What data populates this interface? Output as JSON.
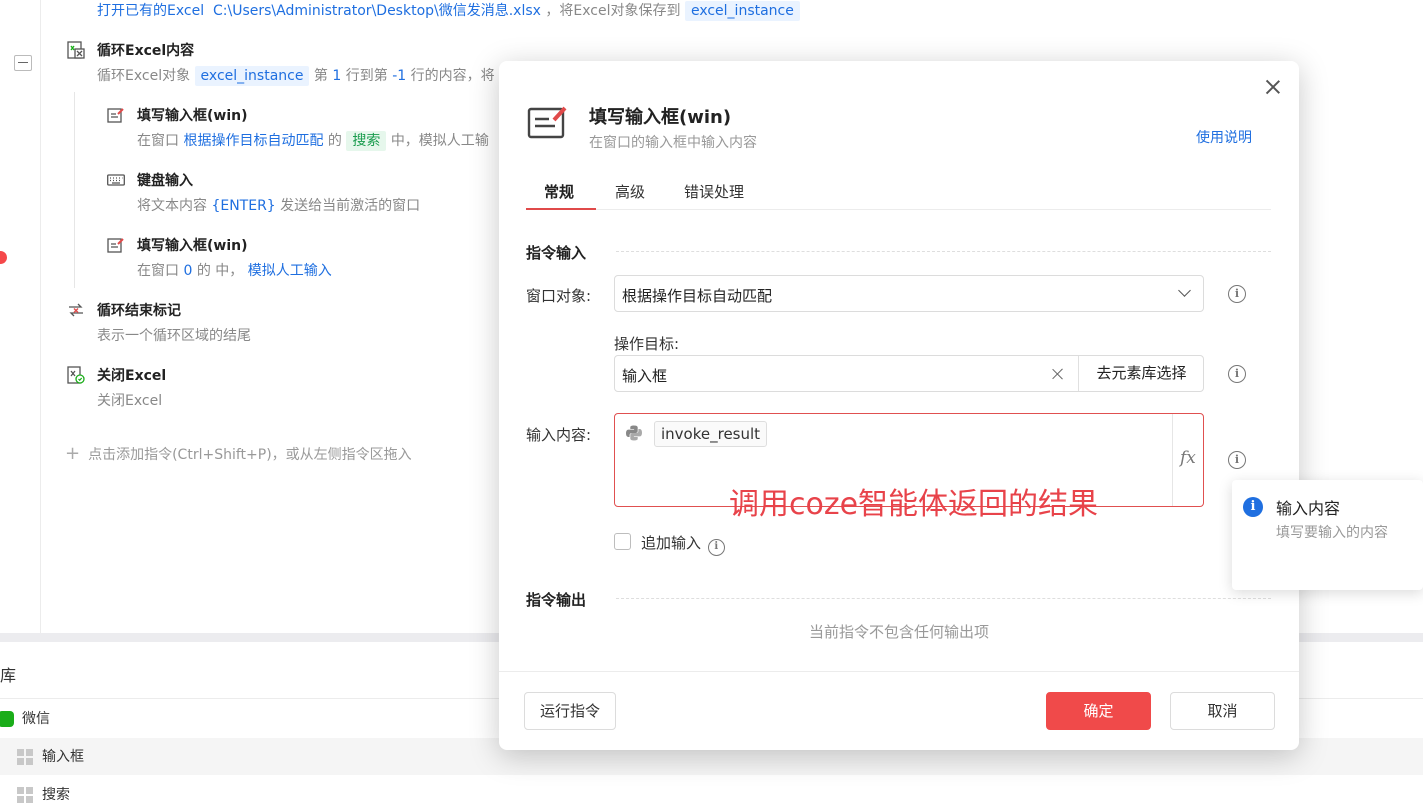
{
  "flow": {
    "top_line": {
      "prefix": "打开已有的Excel",
      "path": "C:\\Users\\Administrator\\Desktop\\微信发消息.xlsx",
      "middle": "，将Excel对象保存到",
      "var": "excel_instance"
    },
    "loop": {
      "title": "循环Excel内容",
      "desc_prefix": "循环Excel对象",
      "var": "excel_instance",
      "desc_1": "第",
      "start": "1",
      "desc_2": "行到第",
      "end": "-1",
      "desc_3": "行的内容，",
      "desc_4": "将"
    },
    "fill1": {
      "title": "填写输入框(win)",
      "desc_prefix": "在窗口",
      "window": "根据操作目标自动匹配",
      "of": "的",
      "target": "搜索",
      "mid": "中，模拟人工",
      "more": "输"
    },
    "keyboard": {
      "title": "键盘输入",
      "desc_prefix": "将文本内容",
      "key": "{ENTER}",
      "desc_suffix": "发送给当前激活的窗口"
    },
    "fill2": {
      "title": "填写输入框(win)",
      "desc_prefix": "在窗口",
      "window": "0",
      "mid": "的 中，",
      "method": "模拟人工输入"
    },
    "loop_end": {
      "title": "循环结束标记",
      "desc": "表示一个循环区域的结尾"
    },
    "close_excel": {
      "title": "关闭Excel",
      "desc": "关闭Excel"
    },
    "add_cmd": "点击添加指令(Ctrl+Shift+P)，或从左侧指令区拖入"
  },
  "library": {
    "title": "库",
    "items": [
      {
        "label": "微信",
        "icon": "wechat-icon"
      },
      {
        "label": "输入框",
        "icon": "windows-icon"
      },
      {
        "label": "搜索",
        "icon": "windows-icon"
      }
    ]
  },
  "dialog": {
    "title": "填写输入框(win)",
    "subtitle": "在窗口的输入框中输入内容",
    "help": "使用说明",
    "tabs": [
      "常规",
      "高级",
      "错误处理"
    ],
    "section_input": "指令输入",
    "window_label": "窗口对象:",
    "window_value": "根据操作目标自动匹配",
    "target_label": "操作目标:",
    "target_value": "输入框",
    "target_pick": "去元素库选择",
    "content_label": "输入内容:",
    "content_var": "invoke_result",
    "fx": "fx",
    "annotation": "调用coze智能体返回的结果",
    "append_label": "追加输入",
    "section_output": "指令输出",
    "no_output": "当前指令不包含任何输出项",
    "run_btn": "运行指令",
    "ok_btn": "确定",
    "cancel_btn": "取消"
  },
  "tooltip": {
    "title": "输入内容",
    "body": "填写要输入的内容"
  },
  "colors": {
    "accent": "#f04a4a",
    "link": "#1f6fe0",
    "annotation": "#e8434a"
  }
}
